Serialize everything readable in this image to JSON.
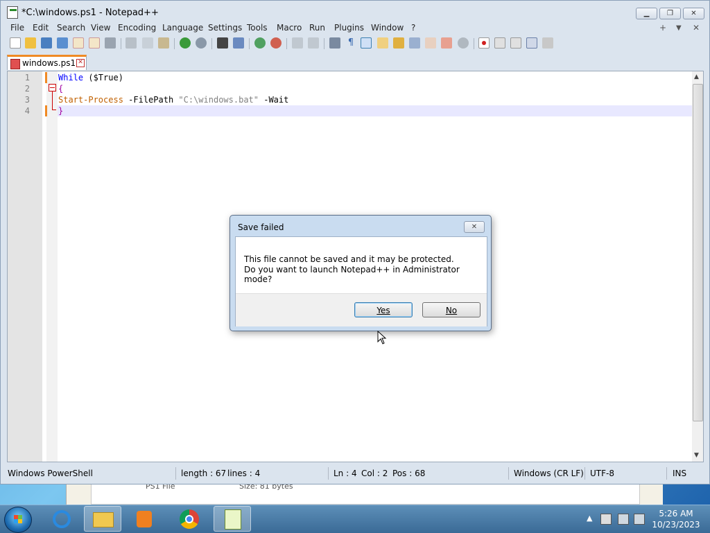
{
  "window": {
    "title": "*C:\\windows.ps1 - Notepad++",
    "caption_buttons": [
      "minimize-icon",
      "restore-icon",
      "close-icon"
    ]
  },
  "menu": [
    "File",
    "Edit",
    "Search",
    "View",
    "Encoding",
    "Language",
    "Settings",
    "Tools",
    "Macro",
    "Run",
    "Plugins",
    "Window",
    "?"
  ],
  "menu_right": [
    "+",
    "▼",
    "✕"
  ],
  "tab": {
    "label": "windows.ps1"
  },
  "editor": {
    "line_numbers": [
      "1",
      "2",
      "3",
      "4"
    ],
    "lines": [
      {
        "t1": "While",
        "t2": " ($True)"
      },
      {
        "t1": "{"
      },
      {
        "t1": "Start-Process",
        "t2": " -FilePath ",
        "t3": "\"C:\\windows.bat\"",
        "t4": " -Wait"
      },
      {
        "t1": "}"
      }
    ]
  },
  "status": {
    "language": "Windows PowerShell",
    "length": "length : 67",
    "lines": "lines : 4",
    "ln": "Ln : 4",
    "col": "Col : 2",
    "pos": "Pos : 68",
    "eol": "Windows (CR LF)",
    "encoding": "UTF-8",
    "mode": "INS"
  },
  "dialog": {
    "title": "Save failed",
    "message_line1": "This file cannot be saved and it may be protected.",
    "message_line2": "Do you want to launch Notepad++ in Administrator mode?",
    "yes": "Yes",
    "no": "No"
  },
  "background_window": {
    "file_type": "PS1 File",
    "size": "Size: 81 bytes"
  },
  "taskbar": {
    "clock_time": "5:26 AM",
    "clock_date": "10/23/2023",
    "apps": [
      "internet-explorer-icon",
      "file-explorer-icon",
      "media-player-icon",
      "chrome-icon",
      "notepadpp-icon"
    ]
  },
  "colors": {
    "keyword": "#0000ff",
    "cmdlet": "#c06000",
    "string": "#808080",
    "tab_accent": "#f08a24"
  }
}
